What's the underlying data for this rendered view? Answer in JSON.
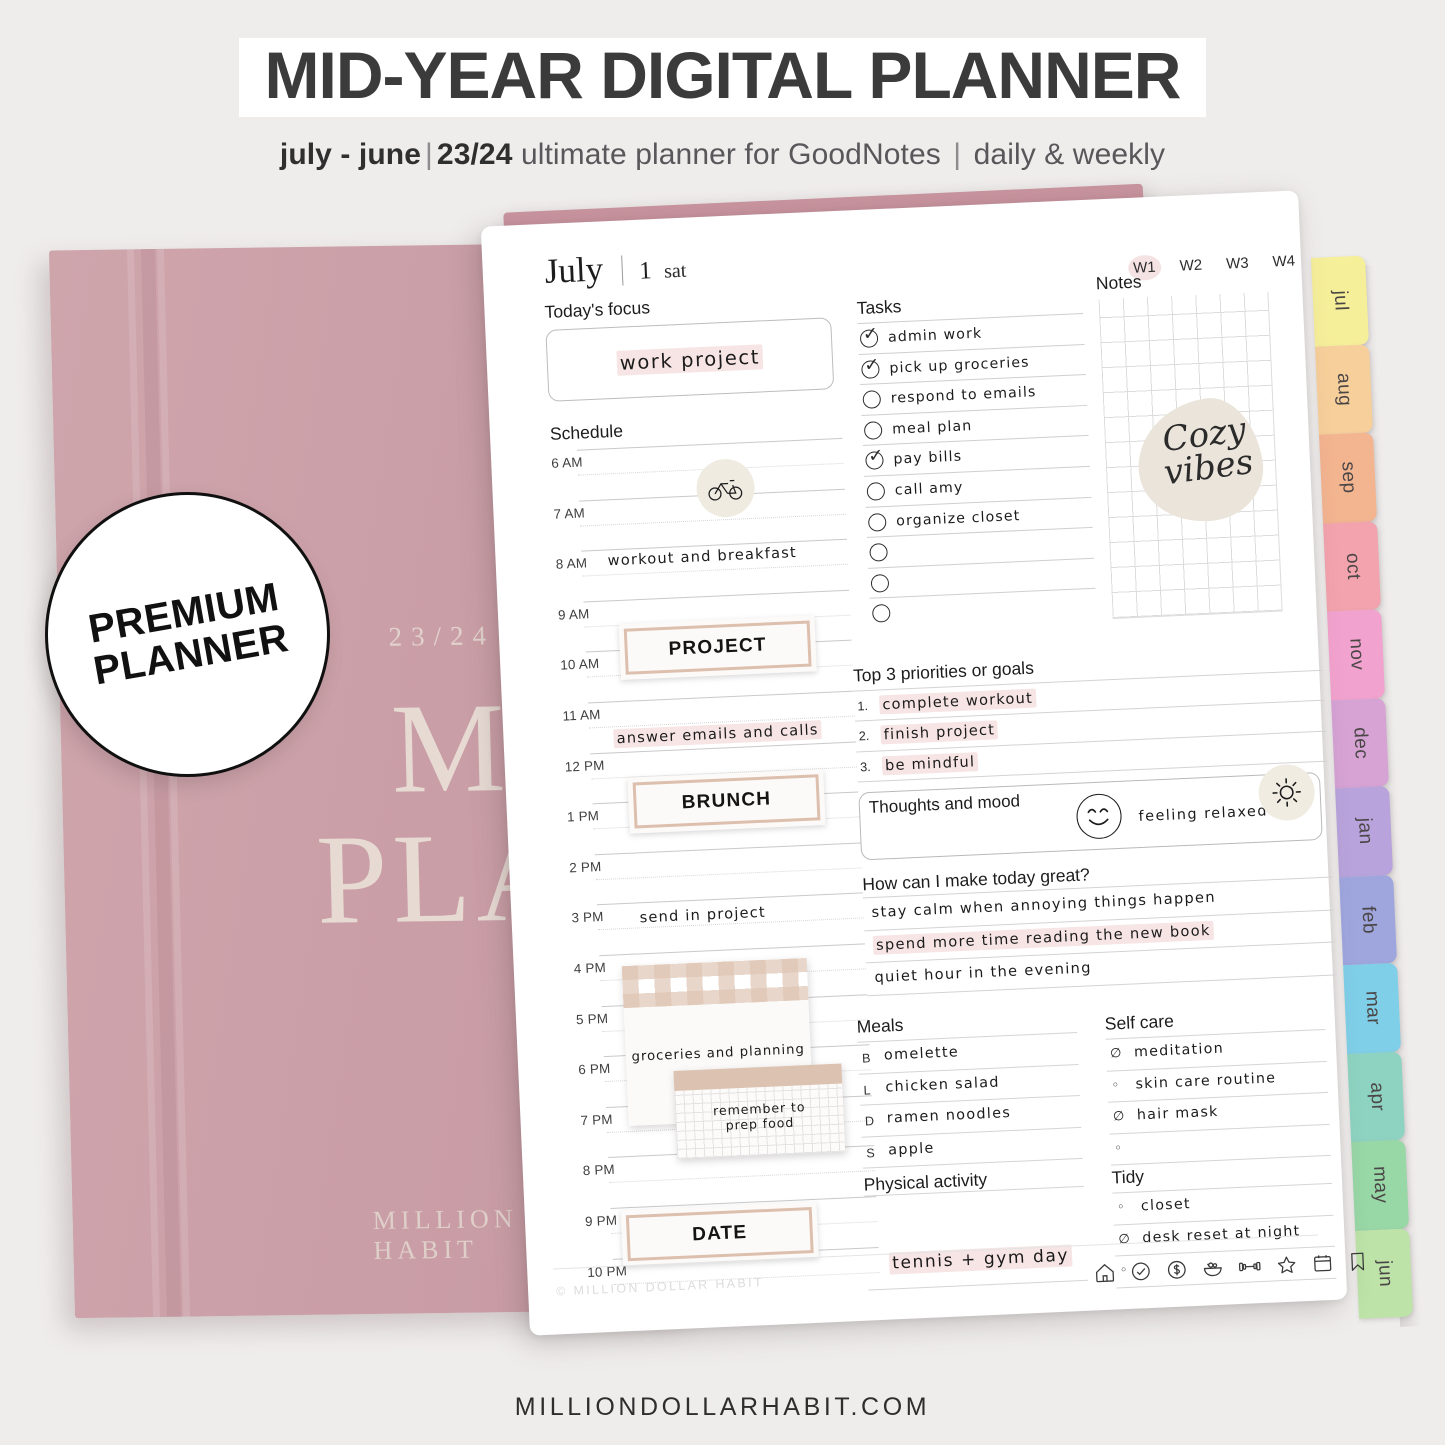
{
  "header": {
    "title": "MID-YEAR DIGITAL PLANNER",
    "sub_a": "july - june",
    "sub_sep1": "|",
    "sub_b": "23/24",
    "sub_c": "ultimate planner for GoodNotes",
    "sub_sep2": "|",
    "sub_d": "daily & weekly"
  },
  "footer": {
    "url": "MILLIONDOLLARHABIT.COM"
  },
  "badge": {
    "line1": "PREMIUM",
    "line2": "PLANNER"
  },
  "book": {
    "year": "23/24",
    "title_line1": "MID",
    "title_line2": "PLANNER",
    "brand": "MILLION DOLLAR HABIT",
    "cover_color": "#cb9fa7"
  },
  "planner": {
    "month": "July",
    "divider": "|",
    "day_number": "1",
    "day_name": "sat",
    "weeks": [
      {
        "label": "W1",
        "active": true
      },
      {
        "label": "W2",
        "active": false
      },
      {
        "label": "W3",
        "active": false
      },
      {
        "label": "W4",
        "active": false
      }
    ],
    "focus": {
      "heading": "Today's focus",
      "value": "work project"
    },
    "schedule": {
      "heading": "Schedule",
      "hours": [
        "6 AM",
        "7 AM",
        "8 AM",
        "9 AM",
        "10 AM",
        "11 AM",
        "12 PM",
        "1 PM",
        "2 PM",
        "3 PM",
        "4 PM",
        "5 PM",
        "6 PM",
        "7 PM",
        "8 PM",
        "9 PM",
        "10 PM"
      ],
      "events": [
        {
          "text": "workout and breakfast",
          "highlight": false
        },
        {
          "text": "answer emails and calls",
          "highlight": true
        },
        {
          "text": "send in project",
          "highlight": false
        }
      ],
      "blocks": [
        {
          "label": "PROJECT"
        },
        {
          "label": "BRUNCH"
        },
        {
          "label": "DATE"
        }
      ],
      "sticky_gingham": "groceries and planning",
      "sticky_grid_line1": "remember to",
      "sticky_grid_line2": "prep food",
      "bike_icon": "bicycle-icon"
    },
    "tasks": {
      "heading": "Tasks",
      "items": [
        {
          "text": "admin work",
          "checked": true
        },
        {
          "text": "pick up groceries",
          "checked": true
        },
        {
          "text": "respond to emails",
          "checked": false
        },
        {
          "text": "meal plan",
          "checked": false
        },
        {
          "text": "pay bills",
          "checked": true
        },
        {
          "text": "call amy",
          "checked": false
        },
        {
          "text": "organize closet",
          "checked": false
        },
        {
          "text": "",
          "checked": false
        },
        {
          "text": "",
          "checked": false
        },
        {
          "text": "",
          "checked": false
        }
      ]
    },
    "priorities": {
      "heading": "Top 3 priorities or goals",
      "items": [
        {
          "n": "1.",
          "text": "complete workout",
          "highlight": true
        },
        {
          "n": "2.",
          "text": "finish project",
          "highlight": true
        },
        {
          "n": "3.",
          "text": "be mindful",
          "highlight": true
        }
      ]
    },
    "mood": {
      "heading": "Thoughts and mood",
      "value": "feeling relaxed",
      "face": "smiley-face-icon"
    },
    "great": {
      "heading": "How can I make today great?",
      "items": [
        {
          "text": "stay calm when annoying things happen",
          "highlight": false
        },
        {
          "text": "spend more time reading the new book",
          "highlight": true
        },
        {
          "text": "quiet hour in the evening",
          "highlight": false
        }
      ],
      "sun_icon": "sun-icon"
    },
    "meals": {
      "heading": "Meals",
      "items": [
        {
          "key": "B",
          "text": "omelette"
        },
        {
          "key": "L",
          "text": "chicken salad"
        },
        {
          "key": "D",
          "text": "ramen noodles"
        },
        {
          "key": "S",
          "text": "apple"
        }
      ]
    },
    "physical": {
      "heading": "Physical activity",
      "value": "tennis + gym day",
      "highlight": true
    },
    "self_care": {
      "heading": "Self care",
      "items": [
        {
          "text": "meditation",
          "checked": true
        },
        {
          "text": "skin care routine",
          "checked": false
        },
        {
          "text": "hair mask",
          "checked": true
        },
        {
          "text": "",
          "checked": false
        }
      ]
    },
    "tidy": {
      "heading": "Tidy",
      "items": [
        {
          "text": "closet",
          "checked": false
        },
        {
          "text": "desk reset at night",
          "checked": true
        },
        {
          "text": "",
          "checked": false
        }
      ]
    },
    "notes": {
      "heading": "Notes",
      "doodle": "cozy\nvibes"
    },
    "copyright": "© MILLION DOLLAR HABIT",
    "iconbar": [
      "home-icon",
      "check-circle-icon",
      "dollar-icon",
      "salad-bowl-icon",
      "dumbbell-icon",
      "star-icon",
      "calendar-icon",
      "bookmark-icon"
    ]
  },
  "month_tabs": [
    {
      "label": "jul",
      "color": "#f6ef9a"
    },
    {
      "label": "aug",
      "color": "#f7cf9b"
    },
    {
      "label": "sep",
      "color": "#f3b490"
    },
    {
      "label": "oct",
      "color": "#f3a3ad"
    },
    {
      "label": "nov",
      "color": "#f2a2ce"
    },
    {
      "label": "dec",
      "color": "#d6a3d4"
    },
    {
      "label": "jan",
      "color": "#b9a3dc"
    },
    {
      "label": "feb",
      "color": "#9fa6de"
    },
    {
      "label": "mar",
      "color": "#7fcfe8"
    },
    {
      "label": "apr",
      "color": "#8ed3c1"
    },
    {
      "label": "may",
      "color": "#98d7a6"
    },
    {
      "label": "jun",
      "color": "#bde3a8"
    }
  ]
}
